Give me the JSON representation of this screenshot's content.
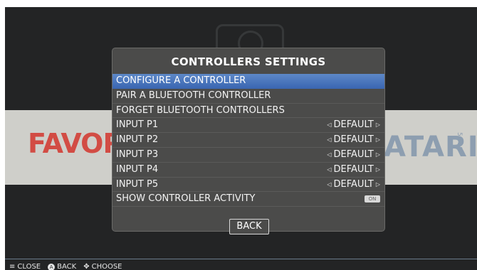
{
  "dialog": {
    "title": "CONTROLLERS SETTINGS",
    "items": [
      {
        "label": "CONFIGURE A CONTROLLER"
      },
      {
        "label": "PAIR A BLUETOOTH CONTROLLER"
      },
      {
        "label": "FORGET BLUETOOTH CONTROLLERS"
      },
      {
        "label": "INPUT P1",
        "value": "DEFAULT"
      },
      {
        "label": "INPUT P2",
        "value": "DEFAULT"
      },
      {
        "label": "INPUT P3",
        "value": "DEFAULT"
      },
      {
        "label": "INPUT P4",
        "value": "DEFAULT"
      },
      {
        "label": "INPUT P5",
        "value": "DEFAULT"
      },
      {
        "label": "SHOW CONTROLLER ACTIVITY",
        "toggle": "ON"
      }
    ],
    "back_label": "BACK"
  },
  "background": {
    "left_text": "FAVORIT",
    "right_text": "ATARI",
    "right_subtext": "5200"
  },
  "footer": {
    "close_label": "CLOSE",
    "back_label": "BACK",
    "choose_label": "CHOOSE"
  },
  "colors": {
    "selected": "#4a76bd",
    "dialog_bg": "#4b4b4a",
    "left_text": "#d24c44",
    "right_text": "#8d9eb0"
  },
  "icons": {
    "left_arrow": "left-arrow-icon",
    "right_arrow": "right-arrow-icon",
    "close": "menu-icon",
    "back": "a-button-icon",
    "choose": "dpad-icon"
  }
}
